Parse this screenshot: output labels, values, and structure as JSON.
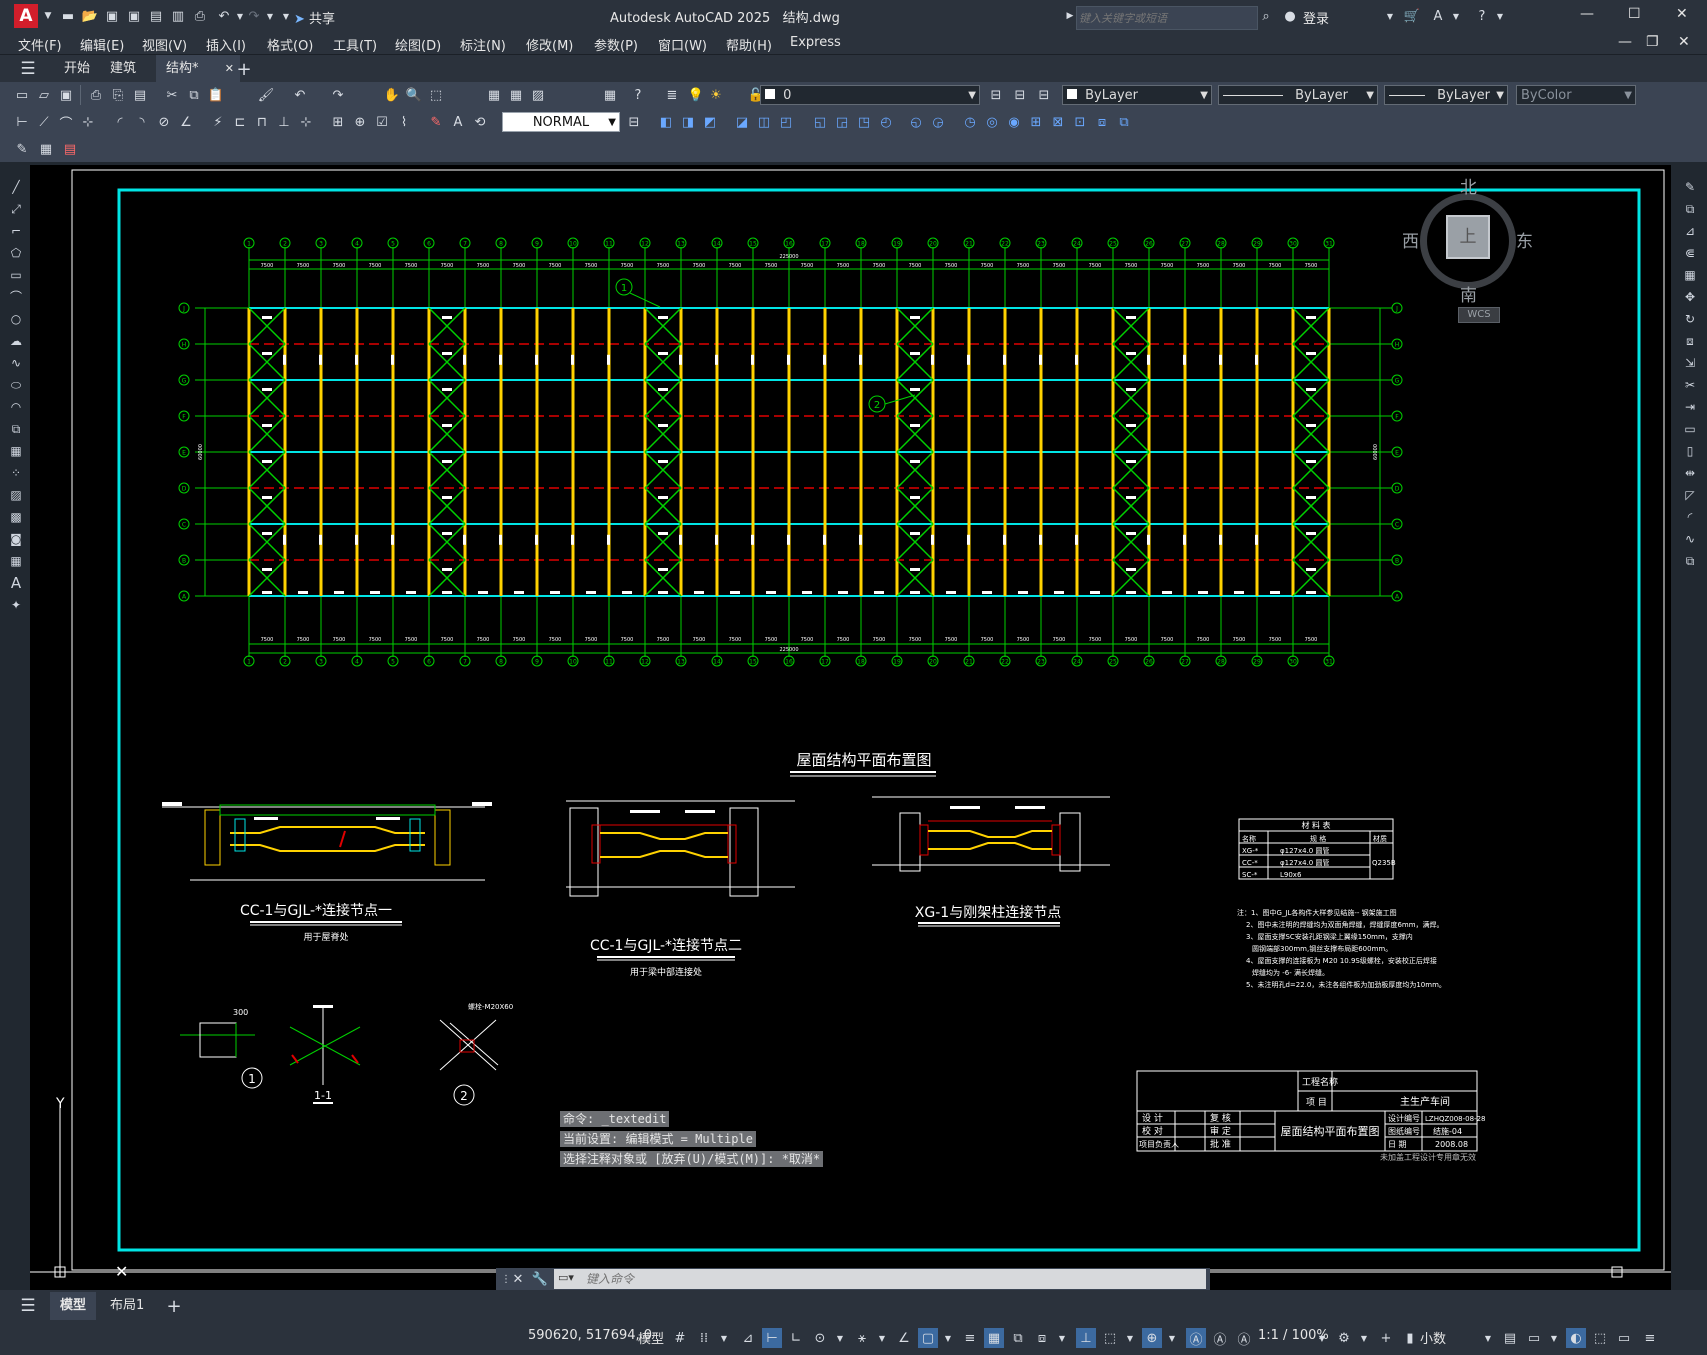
{
  "app": {
    "title": "Autodesk AutoCAD 2025",
    "filename": "结构.dwg",
    "share_label": "共享",
    "search_placeholder": "键入关键字或短语",
    "login_label": "登录"
  },
  "menus": [
    "文件(F)",
    "编辑(E)",
    "视图(V)",
    "插入(I)",
    "格式(O)",
    "工具(T)",
    "绘图(D)",
    "标注(N)",
    "修改(M)",
    "参数(P)",
    "窗口(W)",
    "帮助(H)",
    "Express"
  ],
  "tabs": [
    {
      "label": "开始",
      "active": false
    },
    {
      "label": "建筑",
      "active": false
    },
    {
      "label": "结构*",
      "active": true
    }
  ],
  "toolbar": {
    "layer_value": "0",
    "color_value": "ByLayer",
    "linetype_value": "ByLayer",
    "lineweight_value": "ByLayer",
    "plotstyle_value": "ByColor",
    "textstyle_value": "NORMAL"
  },
  "viewcube": {
    "north": "北",
    "south": "南",
    "east": "东",
    "west": "西",
    "top": "上",
    "wcs": "WCS"
  },
  "drawing": {
    "plan_title": "屋面结构平面布置图",
    "total_dim": "225000",
    "span_dim": "7500",
    "depth_dim": "60000",
    "row_labels": [
      "J",
      "H",
      "G",
      "F",
      "E",
      "D",
      "C",
      "B",
      "A"
    ],
    "col_labels": [
      "1",
      "2",
      "3",
      "4",
      "5",
      "6",
      "7",
      "8",
      "9",
      "10",
      "11",
      "12",
      "13",
      "14",
      "15",
      "16",
      "17",
      "18",
      "19",
      "20",
      "21",
      "22",
      "23",
      "24",
      "25",
      "26",
      "27",
      "28",
      "29",
      "30",
      "31"
    ],
    "callout_1": "1",
    "callout_2": "2",
    "detail1_title": "CC-1与GJL-*连接节点一",
    "detail1_sub": "用于屋脊处",
    "detail2_title": "CC-1与GJL-*连接节点二",
    "detail2_sub": "用于梁中部连接处",
    "detail3_title": "XG-1与刚架柱连接节点",
    "section_label": "1-1",
    "mat_table_title": "材 料 表",
    "mat_headers": [
      "名称",
      "规 格",
      "材质"
    ],
    "mat_rows": [
      [
        "XG-*",
        "φ127x4.0 圆管"
      ],
      [
        "CC-*",
        "φ127x4.0 圆管"
      ],
      [
        "SC-*",
        "L90x6"
      ]
    ],
    "mat_material": "Q235B",
    "notes": [
      "注：1、图中G_JL各构件大样参见结施-- 钢架施工图",
      "2、图中未注明的焊缝均为双面角焊缝，焊缝厚度6mm，满焊。",
      "3、屋面支撑SC安装孔距钢梁上翼缘150mm，支撑内",
      "圆钢端部300mm,钢丝支撑布局距600mm。",
      "4、屋面支撑的连接板为 M20 10.9S级螺栓，安装校正后焊接",
      "焊缝均为 -6- 满长焊缝。",
      "5、未注明孔d=22.0，未注各组件板为加劲板厚度均为10mm。"
    ],
    "title_block": {
      "project_label": "工程名称",
      "item_label": "项 目",
      "item_value": "主生产车间",
      "drawing_title": "屋面结构平面布置图",
      "design": "设 计",
      "check": "校 对",
      "review": "复 核",
      "approve": "审 定",
      "pm": "项目负责人",
      "approver": "批 准",
      "code_label": "设计编号",
      "code_value": "LZHQZ008-08-28",
      "sheet_label": "图纸编号",
      "sheet_value": "结施-04",
      "date_label": "日 期",
      "date_value": "2008.08",
      "footnote": "未加盖工程设计专用章无效"
    },
    "ucs_y": "Y"
  },
  "command": {
    "line1": "命令: _textedit",
    "line2": "当前设置: 编辑模式 = Multiple",
    "line3": "选择注释对象或 [放弃(U)/模式(M)]: *取消*",
    "placeholder": "键入命令"
  },
  "layout_tabs": [
    {
      "label": "模型",
      "active": true
    },
    {
      "label": "布局1",
      "active": false
    }
  ],
  "status": {
    "coords": "590620, 517694, 0",
    "model": "模型",
    "scale": "1:1 / 100%",
    "units": "小数"
  },
  "colors": {
    "cyan": "#00e5e5",
    "green": "#00d000",
    "yellow": "#ffd200",
    "red": "#e00000",
    "white": "#ffffff"
  }
}
